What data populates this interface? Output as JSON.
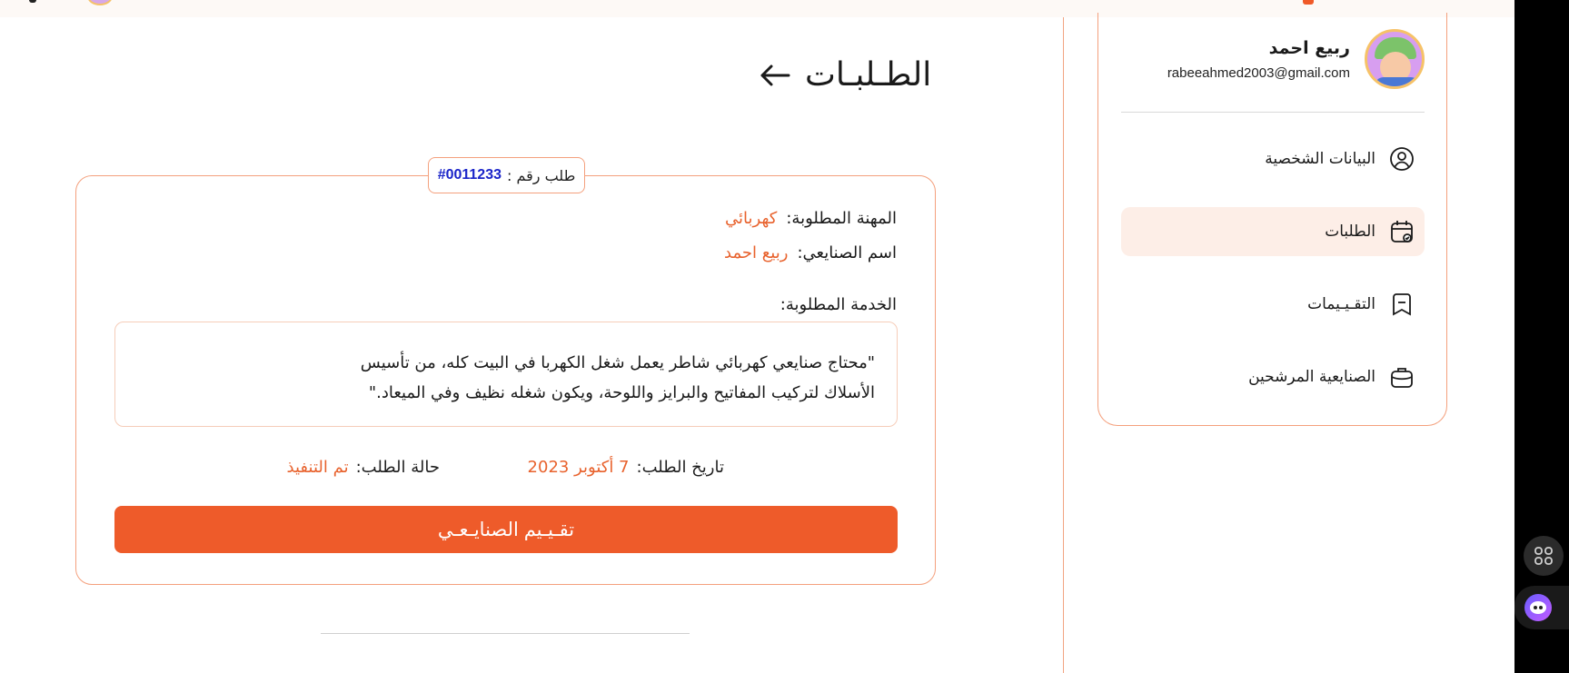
{
  "sidebar": {
    "profile": {
      "name": "ربيع احمد",
      "email": "rabeeahmed2003@gmail.com"
    },
    "items": [
      {
        "label": "البيانات الشخصية",
        "icon": "user-circle-icon",
        "active": false
      },
      {
        "label": "الطلبات",
        "icon": "calendar-check-icon",
        "active": true
      },
      {
        "label": "التقـيـيمات",
        "icon": "bookmark-icon",
        "active": false
      },
      {
        "label": "الصنايعية المرشحين",
        "icon": "briefcase-icon",
        "active": false
      }
    ]
  },
  "main": {
    "title": "الطـلبـات",
    "order": {
      "tag_label": "طلب رقم :",
      "tag_number": "#0011233",
      "profession_label": "المهنة المطلوبة:",
      "profession_value": "كهربائي",
      "worker_label": "اسم الصنايعي:",
      "worker_value": "ربيع احمد",
      "service_label": "الخدمة المطلوبة:",
      "service_text_line1": "\"محتاج صنايعي كهربائي شاطر يعمل شغل الكهربا في البيت كله، من تأسيس",
      "service_text_line2": "الأسلاك لتركيب المفاتيح والبرايز واللوحة، ويكون شغله نظيف وفي الميعاد.\"",
      "date_label": "تاريخ الطلب:",
      "date_value": "7 أكتوبر 2023",
      "status_label": "حالة الطلب:",
      "status_value": "تم التنفيذ",
      "rate_button": "تقـيـيم الصنايـعـي"
    }
  },
  "colors": {
    "accent": "#ee5b2a",
    "accent_light": "#fdeee7",
    "border": "#f4a07d",
    "order_number": "#1a24c9"
  }
}
